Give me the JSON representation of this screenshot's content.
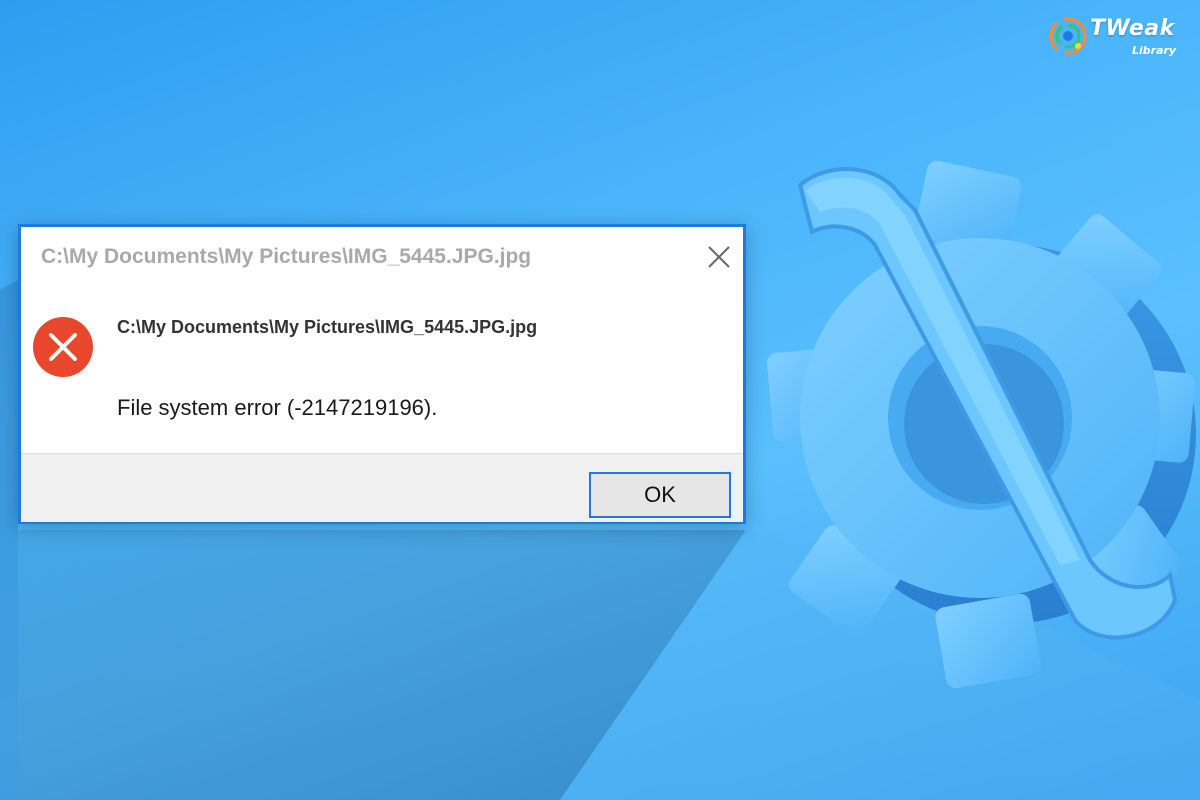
{
  "brand": {
    "name": "TWeak",
    "sub": "Library",
    "logo_icon": "tweak-library-logo-icon"
  },
  "dialog": {
    "title": "C:\\My Documents\\My Pictures\\IMG_5445.JPG.jpg",
    "close_icon": "close-icon",
    "error_icon": "error-x-circle-icon",
    "message_path": "C:\\My Documents\\My Pictures\\IMG_5445.JPG.jpg",
    "message_detail": "File system error (-2147219196).",
    "ok_label": "OK"
  },
  "background": {
    "illustration": "wrench-gear-settings-icon"
  },
  "colors": {
    "accent": "#1f7ae0",
    "error_red": "#e8472b",
    "background_blue": "#4ab5fb"
  }
}
